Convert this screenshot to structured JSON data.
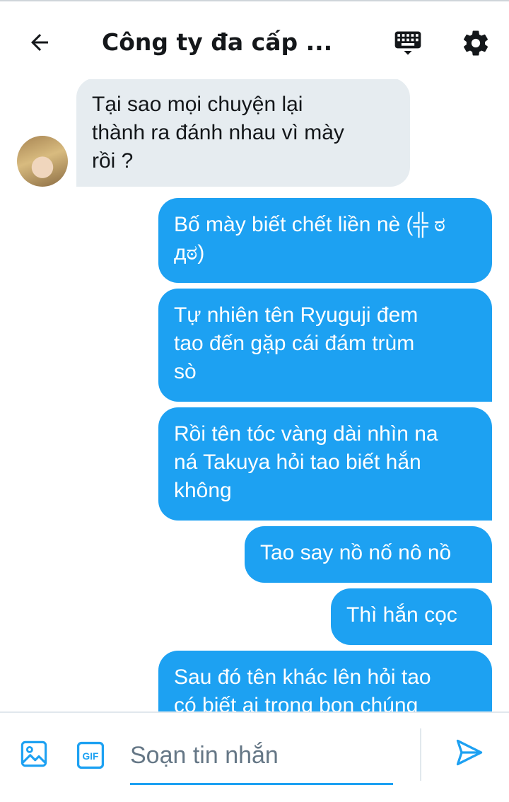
{
  "header": {
    "title": "Công ty đa cấp ...",
    "back_icon": "arrow-left-icon",
    "keyboard_icon": "keyboard-icon",
    "settings_icon": "gear-icon"
  },
  "messages": [
    {
      "direction": "incoming",
      "text": "Tại sao mọi chuyện lại\nthành ra đánh nhau vì mày\nrồi ?"
    },
    {
      "direction": "outgoing",
      "text": "Bố mày biết chết liền nè (╬ ಠ\nдಠ)"
    },
    {
      "direction": "outgoing",
      "text": "Tự nhiên tên Ryuguji đem\ntao đến gặp cái đám trùm\nsò"
    },
    {
      "direction": "outgoing",
      "text": "Rồi tên tóc vàng dài nhìn na\nná Takuya hỏi tao biết hắn\nkhông"
    },
    {
      "direction": "outgoing",
      "text": "Tao say nồ nố nô nồ"
    },
    {
      "direction": "outgoing",
      "text": "Thì hắn cọc"
    },
    {
      "direction": "outgoing",
      "text": "Sau đó tên khác lên hỏi tao\ncó biết ai trong bọn chúng"
    }
  ],
  "composer": {
    "placeholder": "Soạn tin nhắn",
    "gif_label": "GIF",
    "image_icon": "image-icon",
    "send_icon": "send-icon"
  },
  "colors": {
    "accent": "#1da1f2",
    "incoming_bubble": "#e6ecf0",
    "text": "#14171a"
  }
}
